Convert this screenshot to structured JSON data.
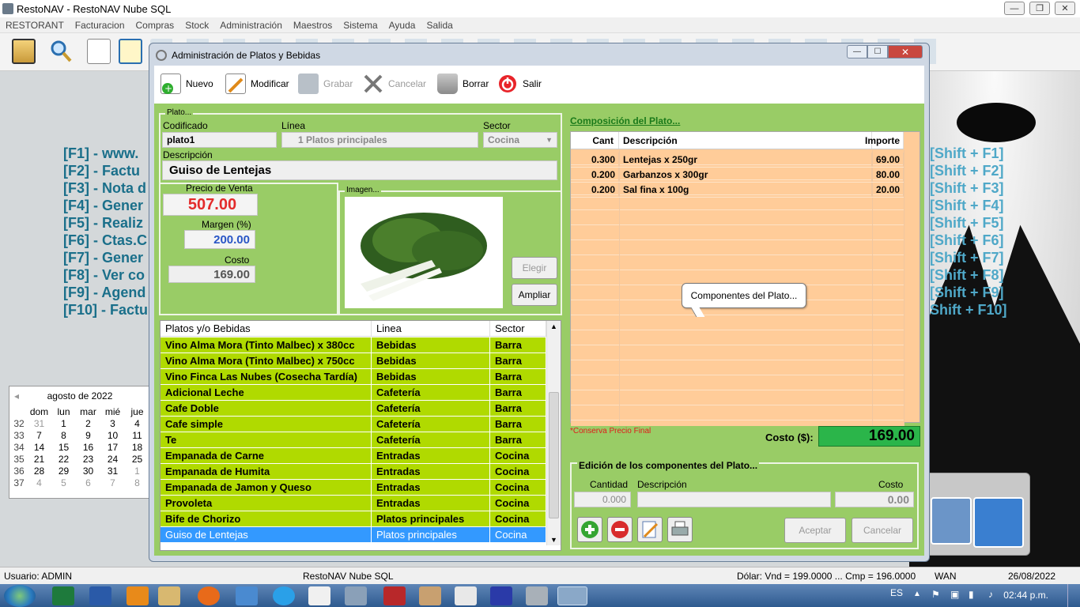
{
  "app": {
    "title": "RestoNAV - RestoNAV Nube SQL"
  },
  "menu": [
    "RESTORANT",
    "Facturacion",
    "Compras",
    "Stock",
    "Administración",
    "Maestros",
    "Sistema",
    "Ayuda",
    "Salida"
  ],
  "fkeys_left": [
    "[F1] - www.",
    "[F2] - Factu",
    "[F3] - Nota d",
    "[F4] - Gener",
    "[F5] - Realiz",
    "[F6] - Ctas.C",
    "[F7] - Gener",
    "[F8] - Ver co",
    "[F9] - Agend",
    "[F10] - Factu"
  ],
  "fkeys_right": [
    "[Shift + F1]",
    "[Shift + F2]",
    "[Shift + F3]",
    "[Shift + F4]",
    "[Shift + F5]",
    "[Shift + F6]",
    "[Shift + F7]",
    "[Shift + F8]",
    "[Shift + F9]",
    "Shift + F10]"
  ],
  "calendar": {
    "title": "agosto de 2022",
    "headers": [
      "dom",
      "lun",
      "mar",
      "mié",
      "jue"
    ],
    "weeks": [
      {
        "wk": "32",
        "days": [
          "31",
          "1",
          "2",
          "3",
          "4"
        ]
      },
      {
        "wk": "33",
        "days": [
          "7",
          "8",
          "9",
          "10",
          "11"
        ]
      },
      {
        "wk": "34",
        "days": [
          "14",
          "15",
          "16",
          "17",
          "18"
        ]
      },
      {
        "wk": "35",
        "days": [
          "21",
          "22",
          "23",
          "24",
          "25"
        ]
      },
      {
        "wk": "36",
        "days": [
          "28",
          "29",
          "30",
          "31",
          "1"
        ]
      },
      {
        "wk": "37",
        "days": [
          "4",
          "5",
          "6",
          "7",
          "8"
        ]
      }
    ]
  },
  "window": {
    "title": "Administración de Platos y Bebidas",
    "toolbar": {
      "nuevo": "Nuevo",
      "modificar": "Modificar",
      "grabar": "Grabar",
      "cancelar": "Cancelar",
      "borrar": "Borrar",
      "salir": "Salir"
    },
    "plato": {
      "group_label": "Plato...",
      "codificado_label": "Codificado",
      "codificado": "plato1",
      "linea_label": "Línea",
      "linea": "1 Platos principales",
      "sector_label": "Sector",
      "sector": "Cocina",
      "descripcion_label": "Descripción",
      "descripcion": "Guiso de Lentejas",
      "precio_label": "Precio de Venta",
      "precio": "507.00",
      "margen_label": "Margen (%)",
      "margen": "200.00",
      "costo_label": "Costo",
      "costo": "169.00",
      "imagen_label": "Imagen...",
      "elegir": "Elegir",
      "ampliar": "Ampliar"
    },
    "list": {
      "headers": [
        "Platos y/o Bebidas",
        "Linea",
        "Sector"
      ],
      "rows": [
        [
          "Vino Alma Mora (Tinto Malbec) x 380cc",
          "Bebidas",
          "Barra"
        ],
        [
          "Vino Alma Mora (Tinto Malbec) x 750cc",
          "Bebidas",
          "Barra"
        ],
        [
          "Vino Finca Las Nubes (Cosecha Tardía)",
          "Bebidas",
          "Barra"
        ],
        [
          "Adicional Leche",
          "Cafetería",
          "Barra"
        ],
        [
          "Cafe Doble",
          "Cafetería",
          "Barra"
        ],
        [
          "Cafe simple",
          "Cafetería",
          "Barra"
        ],
        [
          "Te",
          "Cafetería",
          "Barra"
        ],
        [
          "Empanada de Carne",
          "Entradas",
          "Cocina"
        ],
        [
          "Empanada de Humita",
          "Entradas",
          "Cocina"
        ],
        [
          "Empanada de Jamon y Queso",
          "Entradas",
          "Cocina"
        ],
        [
          "Provoleta",
          "Entradas",
          "Cocina"
        ],
        [
          "Bife de Chorizo",
          "Platos principales",
          "Cocina"
        ],
        [
          "Guiso de Lentejas",
          "Platos principales",
          "Cocina"
        ]
      ]
    },
    "composicion": {
      "title": "Composición del Plato...",
      "headers": [
        "Cant",
        "Descripción",
        "Importe"
      ],
      "rows": [
        [
          "0.300",
          "Lentejas x 250gr",
          "69.00"
        ],
        [
          "0.200",
          "Garbanzos x 300gr",
          "80.00"
        ],
        [
          "0.200",
          "Sal fina x 100g",
          "20.00"
        ]
      ],
      "tooltip": "Componentes del Plato...",
      "conserva": "*Conserva Precio Final",
      "costo_label": "Costo ($):",
      "costo": "169.00"
    },
    "edicion": {
      "title": "Edición de los componentes del Plato...",
      "cantidad_label": "Cantidad",
      "descripcion_label": "Descripción",
      "costo_label": "Costo",
      "cantidad": "0.000",
      "costo": "0.00",
      "aceptar": "Aceptar",
      "cancelar": "Cancelar"
    }
  },
  "status": {
    "usuario": "Usuario: ADMIN",
    "app": "RestoNAV Nube SQL",
    "dolar": "Dólar: Vnd = 199.0000 ... Cmp = 196.0000",
    "wan": "WAN",
    "fecha": "26/08/2022"
  },
  "taskbar": {
    "lang": "ES",
    "clock": "02:44 p.m."
  }
}
